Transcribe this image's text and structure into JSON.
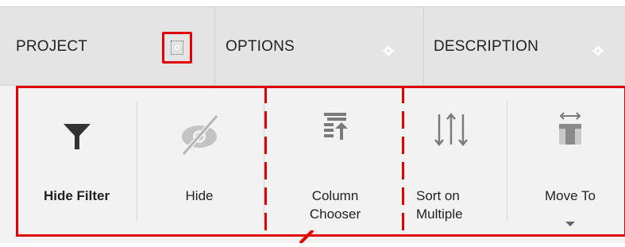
{
  "header": {
    "columns": [
      {
        "label": "PROJECT",
        "settings_icon": "gear-icon"
      },
      {
        "label": "OPTIONS",
        "settings_icon": "gear-icon"
      },
      {
        "label": "DESCRIPTION",
        "settings_icon": "gear-icon"
      }
    ]
  },
  "toolbar": {
    "items": [
      {
        "label": "Hide Filter",
        "icon": "filter-icon",
        "bold": true
      },
      {
        "label": "Hide",
        "icon": "eye-hidden-icon"
      },
      {
        "label_line1": "Column",
        "label_line2": "Chooser",
        "icon": "column-chooser-icon"
      },
      {
        "label_line1": "Sort on",
        "label_line2": "Multiple",
        "icon": "sort-multiple-icon"
      },
      {
        "label": "Move To",
        "icon": "move-column-icon",
        "has_dropdown": true
      }
    ]
  },
  "colors": {
    "highlight": "#e00000",
    "header_bg": "#e4e4e4",
    "toolbar_bg": "#f2f2f2"
  }
}
